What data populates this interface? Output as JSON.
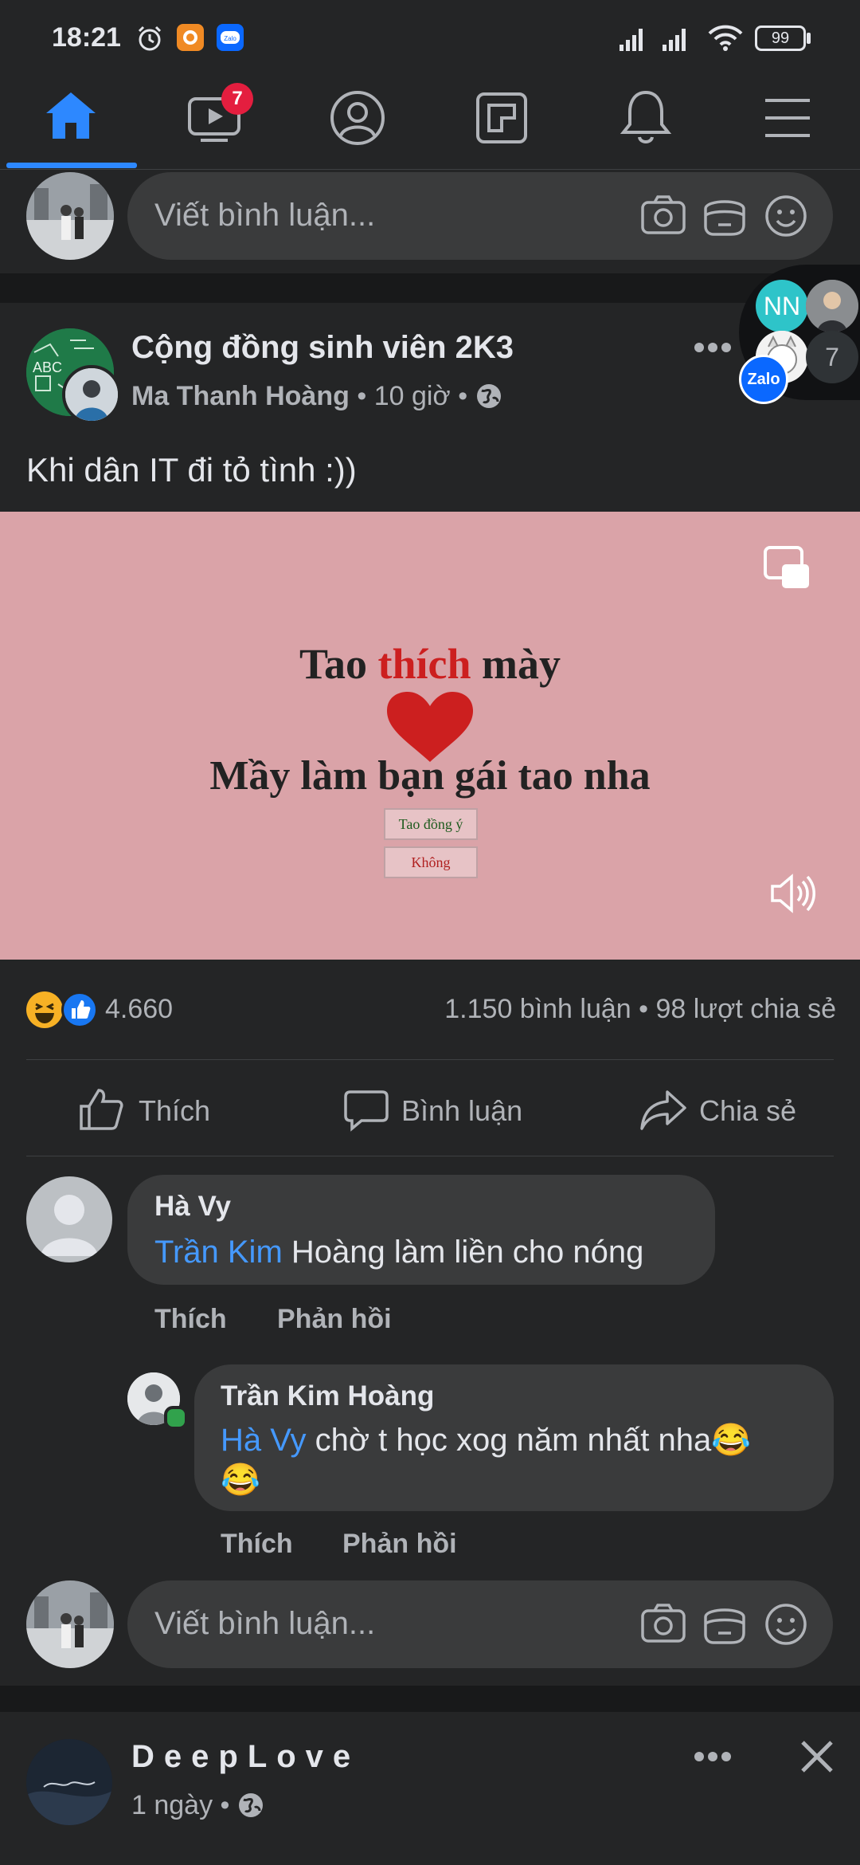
{
  "status_bar": {
    "time": "18:21",
    "battery": "99"
  },
  "nav": {
    "tabs": [
      {
        "name": "home",
        "icon": "home-icon",
        "active": true
      },
      {
        "name": "watch",
        "icon": "video-icon",
        "badge": "7"
      },
      {
        "name": "profile",
        "icon": "profile-icon"
      },
      {
        "name": "pages",
        "icon": "feed-icon"
      },
      {
        "name": "notifications",
        "icon": "bell-icon"
      },
      {
        "name": "menu",
        "icon": "hamburger-icon"
      }
    ]
  },
  "comment_placeholder": "Viết bình luận...",
  "chat_heads": {
    "initials": "NN",
    "count": "7",
    "app_label": "Zalo"
  },
  "post": {
    "group_name": "Cộng đồng sinh viên 2K3",
    "author": "Ma Thanh Hoàng",
    "time": "10 giờ",
    "separator": "•",
    "text": "Khi dân IT đi tỏ tình :))",
    "video": {
      "line1_a": "Tao ",
      "line1_b": "thích",
      "line1_c": " mày",
      "line2": "Mầy làm bạn gái tao nha",
      "btn_yes": "Tao đồng ý",
      "btn_no": "Không"
    },
    "reactions_count": "4.660",
    "stats": "1.150 bình luận • 98 lượt chia sẻ",
    "actions": {
      "like": "Thích",
      "comment": "Bình luận",
      "share": "Chia sẻ"
    }
  },
  "comments": [
    {
      "name": "Hà Vy",
      "mention": "Trần Kim",
      "text": " Hoàng làm liền cho nóng",
      "like": "Thích",
      "reply": "Phản hồi"
    },
    {
      "name": "Trần Kim Hoàng",
      "mention": "Hà Vy",
      "text": " chờ t học xog năm nhất nha😂",
      "text2": "😂",
      "like": "Thích",
      "reply": "Phản hồi"
    }
  ],
  "next_post": {
    "page_name": "DeepLove",
    "time": "1 ngày",
    "separator": "•"
  },
  "colors": {
    "accent": "#2d88ff",
    "background": "#18191a",
    "card": "#242526",
    "bubble": "#3a3b3c",
    "mention": "#4599ff",
    "badge": "#e41e3f",
    "video_bg": "#daa3a8",
    "heart": "#cc1f1f"
  }
}
